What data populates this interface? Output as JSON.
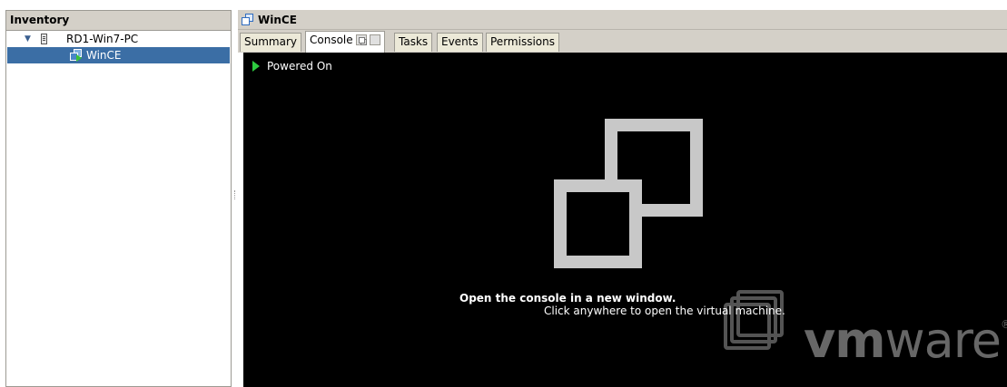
{
  "inventory": {
    "header": "Inventory",
    "host": {
      "label": "RD1-Win7-PC",
      "expanded_glyph": "▼",
      "icon": "server-icon"
    },
    "vm": {
      "label": "WinCE",
      "icon": "vm-powered-on-icon",
      "selected": true
    }
  },
  "vm_panel": {
    "title": "WinCE",
    "title_icon": "virtual-machine-icon",
    "tabs": [
      {
        "label": "Summary",
        "active": false
      },
      {
        "label": "Console",
        "active": true
      },
      {
        "label": "Tasks",
        "active": false
      },
      {
        "label": "Events",
        "active": false
      },
      {
        "label": "Permissions",
        "active": false
      }
    ],
    "console": {
      "power_state": "Powered On",
      "open_message": "Open the console in a new window.",
      "hint": "Click anywhere to open the virtual machine.",
      "brand_vm": "vm",
      "brand_ware": "ware",
      "brand_mark": "®"
    }
  },
  "colors": {
    "selection": "#3b6ea5",
    "chrome": "#d4d0c8",
    "console_bg": "#000000",
    "icon_grey": "#c8c8c8",
    "power_green": "#2ecc40"
  }
}
